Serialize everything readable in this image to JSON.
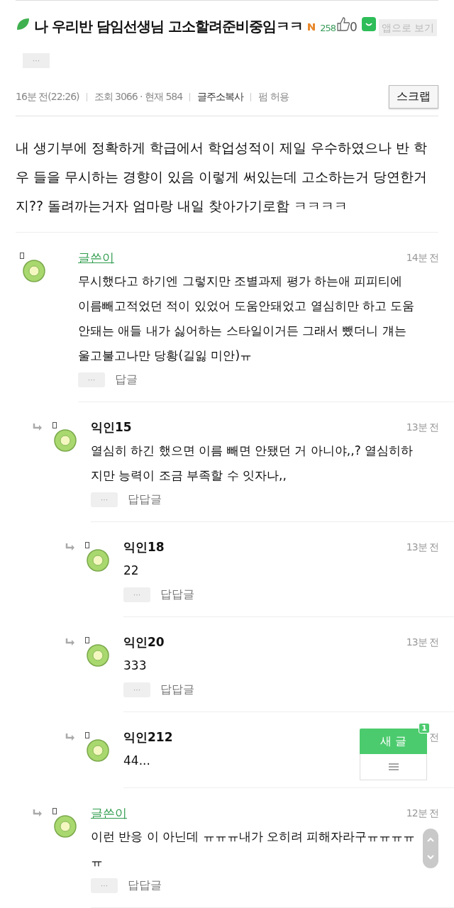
{
  "post": {
    "title": "나 우리반 담임선생님 고소할려준비중임ㅋㅋ",
    "views_badge": "258",
    "likes": "0",
    "app_view": "앱으로 보기",
    "more": "···",
    "meta": [
      "16분 전(22:26)",
      "조회 3066 · 현재 584"
    ],
    "links": [
      "글주소복사",
      "펌 허용"
    ],
    "scrap": "스크랩",
    "body": "내 생기부에 정확하게 학급에서 학업성적이 제일 우수하였으나 반 학우 들을 무시하는 경향이 있음 이렇게 써있는데 고소하는거 당연한거지?? 돌려까는거자 엄마랑 내일 찾아가기로함 ㅋㅋㅋㅋ"
  },
  "comments": [
    {
      "author": "글쓴이",
      "is_author": true,
      "time": "14분 전",
      "text": "무시했다고 하기엔 그렇지만 조별과제 평가 하는애 피피티에 이름빼고적었던 적이 있었어 도움안돼었고 열심히만 하고 도움안돼는 애들 내가 싫어하는 스타일이거든 그래서 뺐더니 걔는 울고불고나만 당황(길잃 미안)ㅠ",
      "more": "···",
      "reply": "답글",
      "children": [
        {
          "author": "익인15",
          "is_author": false,
          "time": "13분 전",
          "text": "열심히 하긴 했으면 이름 빼면 안됐던 거 아니야,,? 열심히하지만 능력이 조금 부족할 수 잇자나,,",
          "more": "···",
          "reply": "답답글",
          "children": [
            {
              "author": "익인18",
              "is_author": false,
              "time": "13분 전",
              "text": "22",
              "more": "···",
              "reply": "답답글"
            },
            {
              "author": "익인20",
              "is_author": false,
              "time": "13분 전",
              "text": "333",
              "more": "···",
              "reply": "답답글"
            },
            {
              "author": "익인212",
              "is_author": false,
              "time": "전",
              "text": "44..."
            }
          ]
        },
        {
          "author": "글쓴이",
          "is_author": true,
          "time": "12분 전",
          "text": "이런 반응 이 아닌데 ㅠㅠㅠ내가 오히려 피해자라구ㅠㅠㅠㅠㅠ",
          "more": "···",
          "reply": "답답글"
        }
      ]
    }
  ],
  "floating": {
    "new_post": "새 글",
    "badge": "1"
  }
}
